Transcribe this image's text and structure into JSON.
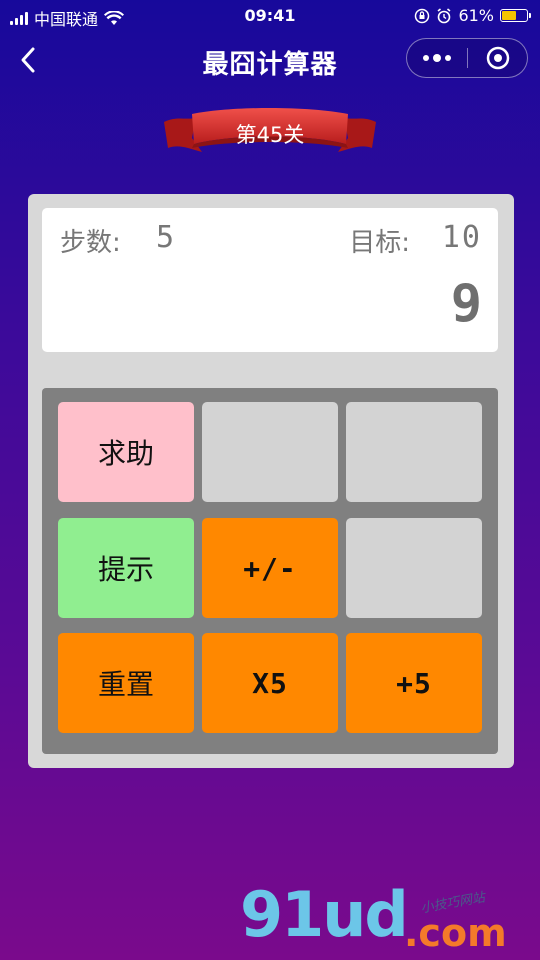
{
  "status_bar": {
    "carrier": "中国联通",
    "time": "09:41",
    "battery": "61%",
    "battery_level": 0.61,
    "battery_color": "#f5c400"
  },
  "nav": {
    "title": "最囧计算器",
    "back_icon": "chevron-left-icon",
    "more_icon": "more-dots-icon",
    "close_icon": "target-circle-icon"
  },
  "level": {
    "label": "第45关"
  },
  "display": {
    "steps_label": "步数:",
    "steps_value": "5",
    "target_label": "目标:",
    "target_value": "10",
    "current_value": "9"
  },
  "keypad": {
    "keys": [
      {
        "label": "求助",
        "color": "#ffc0cb"
      },
      {
        "label": "",
        "color": "#d3d3d3"
      },
      {
        "label": "",
        "color": "#d3d3d3"
      },
      {
        "label": "提示",
        "color": "#90ee90"
      },
      {
        "label": "+/-",
        "color": "#ff8800"
      },
      {
        "label": "",
        "color": "#d3d3d3"
      },
      {
        "label": "重置",
        "color": "#ff8800"
      },
      {
        "label": "X5",
        "color": "#ff8800"
      },
      {
        "label": "+5",
        "color": "#ff8800"
      }
    ]
  },
  "watermark": {
    "main": "91ud",
    "dot_com": ".com",
    "sub": "小技巧网站"
  },
  "colors": {
    "background_top": "#17099b",
    "background_bottom": "#7a0a8c",
    "ribbon": "#d9302c"
  }
}
